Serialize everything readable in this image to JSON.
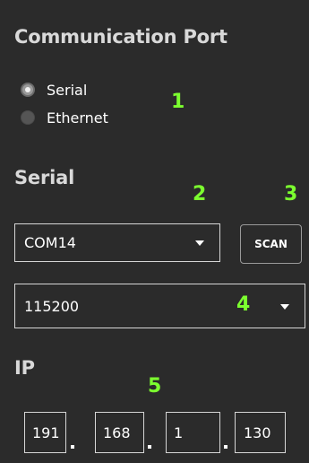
{
  "communication_port": {
    "title": "Communication Port",
    "options": [
      {
        "label": "Serial",
        "checked": true
      },
      {
        "label": "Ethernet",
        "checked": false
      }
    ]
  },
  "serial": {
    "title": "Serial",
    "port_value": "COM14",
    "scan_label": "SCAN",
    "baud_value": "115200"
  },
  "ip": {
    "title": "IP",
    "octets": [
      "191",
      "168",
      "1",
      "130"
    ]
  },
  "callouts": [
    "1",
    "2",
    "3",
    "4",
    "5"
  ],
  "colors": {
    "background": "#2b2b2b",
    "callout": "#7cff2f",
    "field_border": "#d6d6d6"
  }
}
